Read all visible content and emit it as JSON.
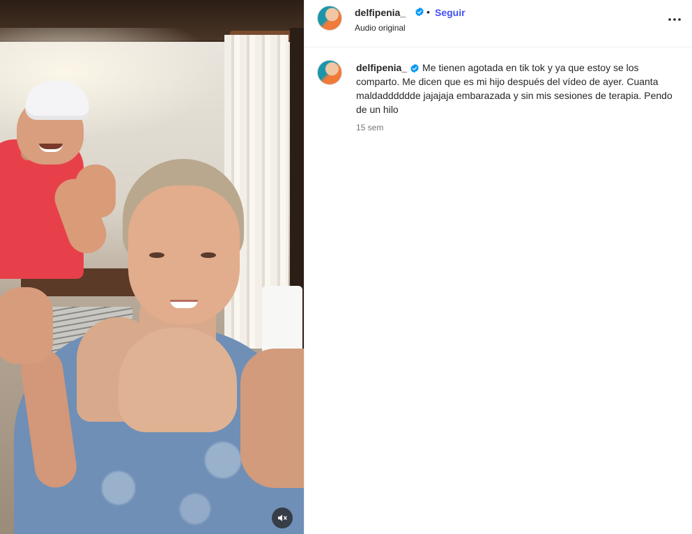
{
  "post": {
    "media": {
      "mute_icon": "speaker-muted-icon"
    },
    "header": {
      "username": "delfipenia_",
      "separator": "•",
      "follow_label": "Seguir",
      "audio_label": "Audio original",
      "more_icon": "more-horizontal-icon"
    },
    "caption": {
      "username": "delfipenia_",
      "text": "Me tienen agotada en tik tok y ya que estoy se los comparto. Me dicen que es mi hijo después del vídeo de ayer. Cuanta maldadddddde jajajaja embarazada y sin mis sesiones de terapia. Pendo de un hilo",
      "time": "15 sem"
    },
    "colors": {
      "follow": "#4150f7",
      "verified": "#0095f6",
      "muted_text": "#737373"
    }
  }
}
